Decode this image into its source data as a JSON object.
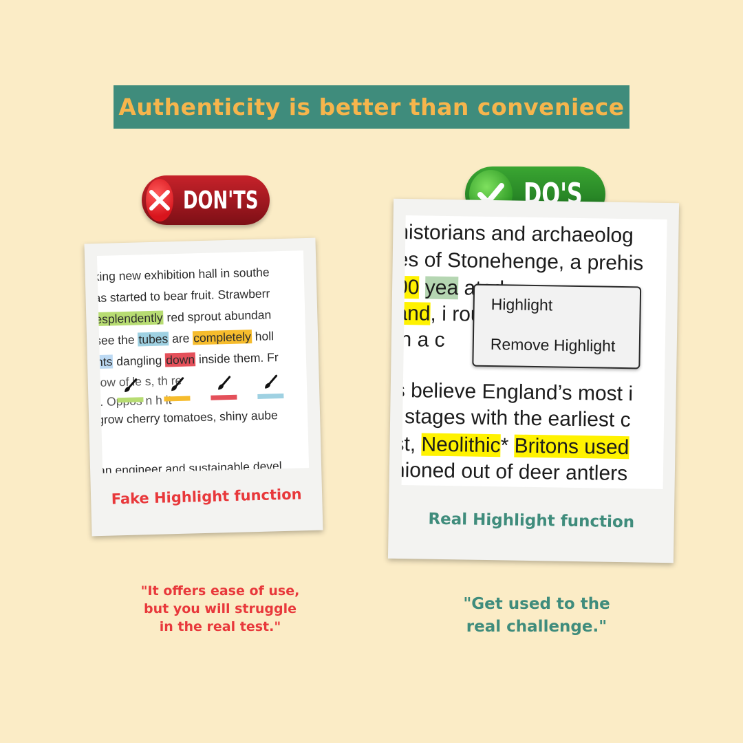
{
  "title": "Authenticity is better than conveniece",
  "donts": {
    "label": "DON'TS",
    "text_lines": [
      {
        "pre": "king new exhibition hall in southe"
      },
      {
        "pre": "as started to bear fruit. Strawberr"
      },
      {
        "h1": "esplendently",
        "t1": " red sprout abundan"
      },
      {
        "pre": "see the ",
        "h1": "tubes",
        "t1": " are ",
        "h2": "completely",
        "t2": " holl"
      },
      {
        "h1": "nts",
        "t1": " dangling ",
        "h2": "down",
        "t2": " inside them. Fr"
      },
      {
        "pre": "row of le          s,       th           re"
      },
      {
        "pre": "t. Oppos                    n           h           it"
      },
      {
        "pre": "grow cherry tomatoes, shiny aube"
      },
      {
        "pre": "an engineer and sustainable devel"
      }
    ],
    "caption": "Fake Highlight function",
    "quote": "\"It offers ease of use,\nbut you will struggle\nin the real test.\"",
    "colors": {
      "red": "#e8383b",
      "green": "#b7dc72",
      "orange": "#f6bc2d",
      "pink": "#e4505a",
      "blue": "#9fd1e2"
    }
  },
  "dos": {
    "label": "DO'S",
    "text_lines": [
      {
        "pre": "historians and archaeolog"
      },
      {
        "pre": "es of Stonehenge, a prehis"
      },
      {
        "h1": "00",
        "t1": " ",
        "h2": "yea",
        "t2": "                          ated"
      },
      {
        "h1": "and",
        "t1": ", i                                   rou"
      },
      {
        "pre": "in a c"
      },
      {
        "pre": "s believe England’s most i"
      },
      {
        "pre": "l stages with the earliest c"
      },
      {
        "pre": "st, ",
        "h1": "Neolithic",
        "t1": "* ",
        "h2": "Britons used"
      },
      {
        "pre": "hioned out of deer antlers"
      }
    ],
    "menu": {
      "highlight": "Highlight",
      "remove": "Remove Highlight"
    },
    "caption": "Real Highlight function",
    "quote": "\"Get used to the\nreal challenge.\"",
    "colors": {
      "teal": "#3f8c7c",
      "yellow": "#fff200"
    }
  }
}
